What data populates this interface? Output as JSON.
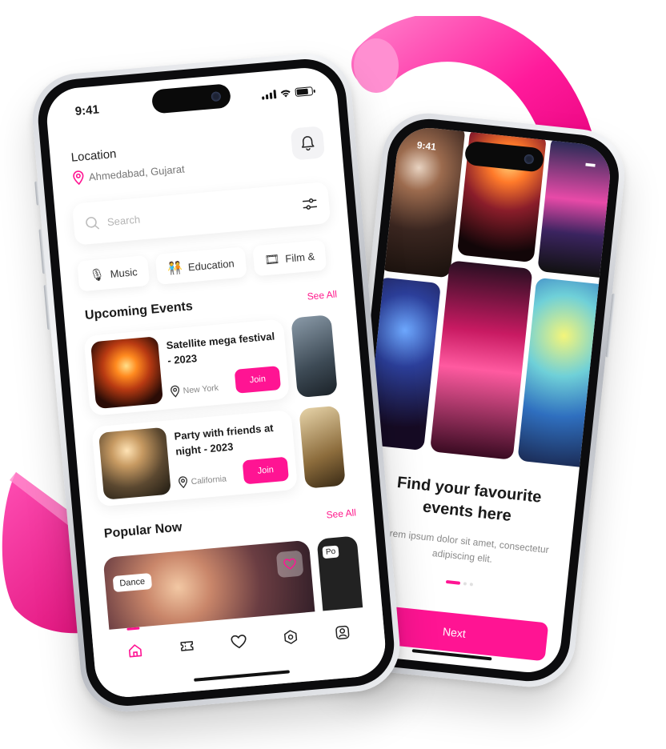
{
  "colors": {
    "accent": "#ff1493",
    "text": "#1a1a1a",
    "muted": "#888888"
  },
  "home_screen": {
    "status_time": "9:41",
    "location_label": "Location",
    "location_value": "Ahmedabad, Gujarat",
    "search_placeholder": "Search",
    "categories": [
      {
        "label": "Music",
        "icon": "microphone-icon"
      },
      {
        "label": "Education",
        "icon": "people-icon"
      },
      {
        "label": "Film &",
        "icon": "film-icon"
      }
    ],
    "upcoming": {
      "title": "Upcoming Events",
      "see_all": "See All",
      "events": [
        {
          "title": "Satellite mega festival - 2023",
          "location": "New York",
          "action": "Join"
        },
        {
          "title": "Party with friends at night - 2023",
          "location": "California",
          "action": "Join"
        }
      ]
    },
    "popular": {
      "title": "Popular Now",
      "see_all": "See All",
      "card_tag": "Dance",
      "peek_tag": "Po"
    },
    "tabs": [
      "home-icon",
      "ticket-icon",
      "heart-icon",
      "hexagon-icon",
      "profile-icon"
    ]
  },
  "onboarding_screen": {
    "status_time": "9:41",
    "title": "Find your favourite events here",
    "subtitle": "Lorem ipsum dolor sit amet, consectetur adipiscing elit.",
    "next_label": "Next",
    "pages_total": 3,
    "current_page": 1
  }
}
